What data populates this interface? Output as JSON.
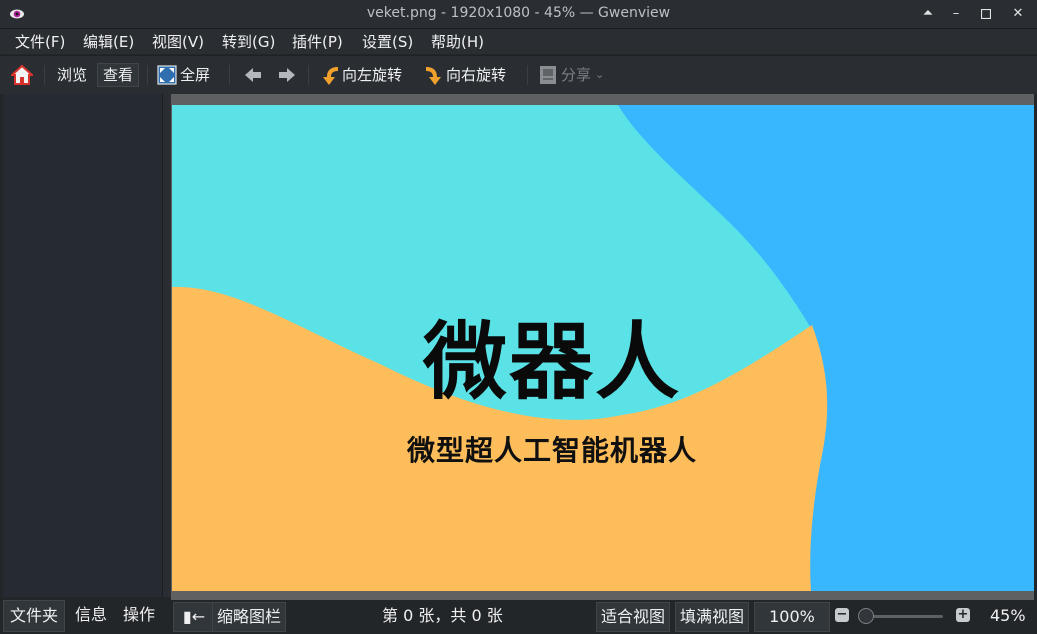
{
  "window": {
    "title": "veket.png - 1920x1080 - 45%  — Gwenview"
  },
  "menu": [
    "文件(F)",
    "编辑(E)",
    "视图(V)",
    "转到(G)",
    "插件(P)",
    "设置(S)",
    "帮助(H)"
  ],
  "toolbar": {
    "browse": "浏览",
    "view": "查看",
    "fullscreen": "全屏",
    "rotate_left": "向左旋转",
    "rotate_right": "向右旋转",
    "share": "分享"
  },
  "image": {
    "title": "微器人",
    "subtitle": "微型超人工智能机器人",
    "colors": {
      "cyan": "#5be2e6",
      "blue": "#38b6fe",
      "orange": "#fdbd5b"
    }
  },
  "sidebar_tabs": [
    "文件夹",
    "信息",
    "操作"
  ],
  "status": {
    "thumbnail_bar": "缩略图栏",
    "count": "第 0 张，共 0 张",
    "fit": "适合视图",
    "fill": "填满视图",
    "percent_100": "100%",
    "zoom": "45%",
    "zoom_fraction": 0.05
  }
}
